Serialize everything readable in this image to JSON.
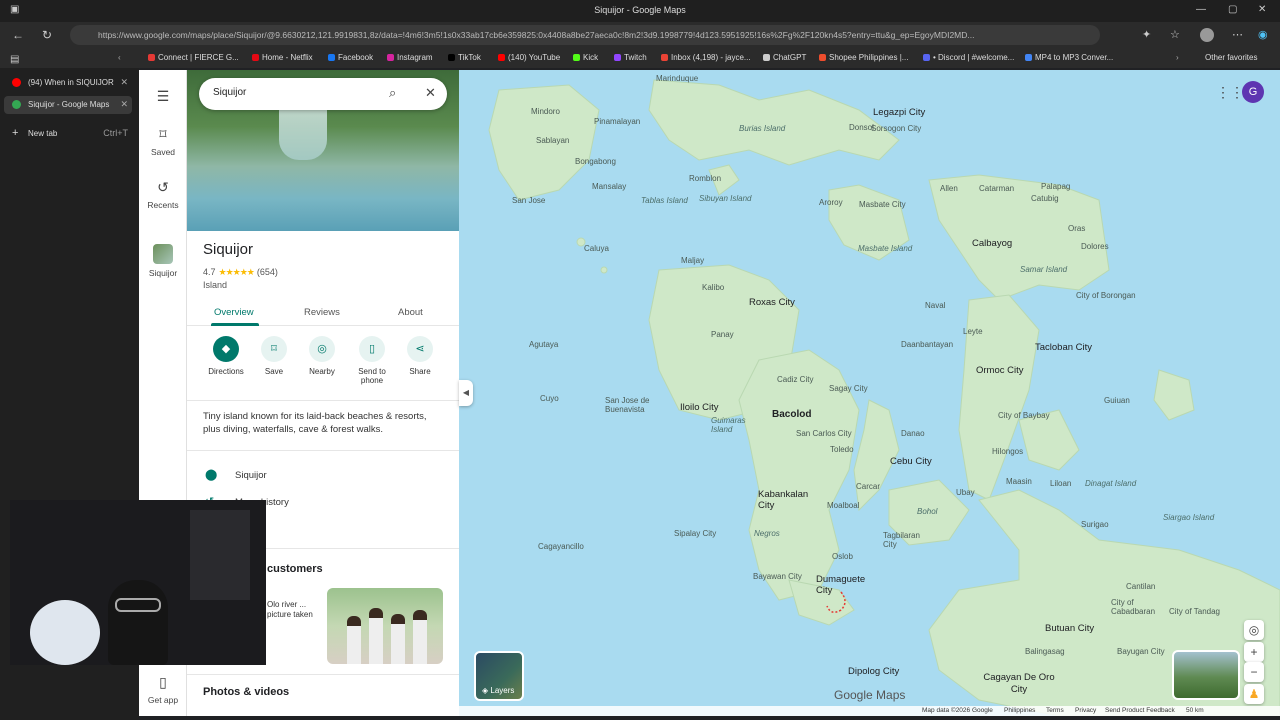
{
  "window": {
    "title": "Siquijor - Google Maps"
  },
  "browser": {
    "url": "https://www.google.com/maps/place/Siquijor/@9.6630212,121.9919831,8z/data=!4m6!3m5!1s0x33ab17cb6e359825:0x4408a8be27aeca0c!8m2!3d9.1998779!4d123.5951925!16s%2Fg%2F120kn4s5?entry=ttu&g_ep=EgoyMDI2MD...",
    "bookmarks": [
      {
        "label": "Connect | FIERCE G...",
        "color": "#e53935"
      },
      {
        "label": "Home - Netflix",
        "color": "#e50914"
      },
      {
        "label": "Facebook",
        "color": "#1877f2"
      },
      {
        "label": "Instagram",
        "color": "#d6249f"
      },
      {
        "label": "TikTok",
        "color": "#000000"
      },
      {
        "label": "(140) YouTube",
        "color": "#ff0000"
      },
      {
        "label": "Kick",
        "color": "#53fc18"
      },
      {
        "label": "Twitch",
        "color": "#9146ff"
      },
      {
        "label": "Inbox (4,198) - jayce...",
        "color": "#ea4335"
      },
      {
        "label": "ChatGPT",
        "color": "#cccccc"
      },
      {
        "label": "Shopee Philippines |...",
        "color": "#ee4d2d"
      },
      {
        "label": "• Discord | #welcome...",
        "color": "#5865f2"
      },
      {
        "label": "MP4 to MP3 Conver...",
        "color": "#4285f4"
      }
    ],
    "other_favorites": "Other favorites",
    "tabs": [
      {
        "label": "(94) When in SIQUIJOR",
        "color": "#ff0000",
        "active": false
      },
      {
        "label": "Siquijor - Google Maps",
        "color": "#34a853",
        "active": true
      }
    ],
    "new_tab": "New tab",
    "new_tab_shortcut": "Ctrl+T"
  },
  "rail": {
    "saved": "Saved",
    "recents": "Recents",
    "recent_place": "Siquijor",
    "get_app": "Get app"
  },
  "search": {
    "value": "Siquijor"
  },
  "place": {
    "name": "Siquijor",
    "rating": "4.7",
    "stars": "★★★★★",
    "reviews": "(654)",
    "type": "Island",
    "tabs": [
      "Overview",
      "Reviews",
      "About"
    ],
    "actions": [
      {
        "label": "Directions",
        "icon": "◆"
      },
      {
        "label": "Save",
        "icon": "⌑"
      },
      {
        "label": "Nearby",
        "icon": "◎"
      },
      {
        "label": "Send to phone",
        "icon": "▯"
      },
      {
        "label": "Share",
        "icon": "⋖"
      }
    ],
    "description": "Tiny island known for its laid-back beaches & resorts, plus diving, waterfalls, cave & forest walks.",
    "info_rows": [
      {
        "label": "Siquijor",
        "icon": "location-pin-icon"
      },
      {
        "label": "Maps history",
        "icon": "history-icon"
      },
      {
        "label": "abel",
        "icon": "label-icon"
      }
    ],
    "section_title": "customers",
    "card_text": "Olo river ... picture taken",
    "photos_title": "Photos & videos"
  },
  "map": {
    "labels": [
      {
        "t": "Marinduque",
        "k": "lbl"
      },
      {
        "t": "Mindoro",
        "k": "lbl"
      },
      {
        "t": "Legazpi City",
        "k": "city"
      },
      {
        "t": "Sorsogon City",
        "k": "lbl"
      },
      {
        "t": "Burias Island",
        "k": "isl"
      },
      {
        "t": "Donsol",
        "k": "lbl"
      },
      {
        "t": "Sablayan",
        "k": "lbl"
      },
      {
        "t": "Pinamalayan",
        "k": "lbl"
      },
      {
        "t": "Bongabong",
        "k": "lbl"
      },
      {
        "t": "Romblon",
        "k": "lbl"
      },
      {
        "t": "Mansalay",
        "k": "lbl"
      },
      {
        "t": "San Jose",
        "k": "lbl"
      },
      {
        "t": "Tablas Island",
        "k": "isl"
      },
      {
        "t": "Sibuyan Island",
        "k": "isl"
      },
      {
        "t": "Aroroy",
        "k": "lbl"
      },
      {
        "t": "Masbate City",
        "k": "lbl"
      },
      {
        "t": "Allen",
        "k": "lbl"
      },
      {
        "t": "Catarman",
        "k": "lbl"
      },
      {
        "t": "Palapag",
        "k": "lbl"
      },
      {
        "t": "Catubig",
        "k": "lbl"
      },
      {
        "t": "Masbate Island",
        "k": "isl"
      },
      {
        "t": "Calbayog",
        "k": "city"
      },
      {
        "t": "Oras",
        "k": "lbl"
      },
      {
        "t": "Dolores",
        "k": "lbl"
      },
      {
        "t": "Samar Island",
        "k": "isl"
      },
      {
        "t": "Caluya",
        "k": "lbl"
      },
      {
        "t": "Maljay",
        "k": "lbl"
      },
      {
        "t": "Kalibo",
        "k": "lbl"
      },
      {
        "t": "Roxas City",
        "k": "city"
      },
      {
        "t": "Naval",
        "k": "lbl"
      },
      {
        "t": "City of Borongan",
        "k": "lbl"
      },
      {
        "t": "Panay",
        "k": "lbl"
      },
      {
        "t": "Leyte",
        "k": "lbl"
      },
      {
        "t": "Agutaya",
        "k": "lbl"
      },
      {
        "t": "Daanbantayan",
        "k": "lbl"
      },
      {
        "t": "Tacloban City",
        "k": "city"
      },
      {
        "t": "Ormoc City",
        "k": "city"
      },
      {
        "t": "Cadiz City",
        "k": "lbl"
      },
      {
        "t": "Sagay City",
        "k": "lbl"
      },
      {
        "t": "Cuyo",
        "k": "lbl"
      },
      {
        "t": "San Jose de Buenavista",
        "k": "lbl"
      },
      {
        "t": "Iloilo City",
        "k": "city"
      },
      {
        "t": "Bacolod",
        "k": "big"
      },
      {
        "t": "Guimaras Island",
        "k": "isl"
      },
      {
        "t": "City of Baybay",
        "k": "lbl"
      },
      {
        "t": "Guiuan",
        "k": "lbl"
      },
      {
        "t": "San Carlos City",
        "k": "lbl"
      },
      {
        "t": "Danao",
        "k": "lbl"
      },
      {
        "t": "Toledo",
        "k": "lbl"
      },
      {
        "t": "Cebu City",
        "k": "city"
      },
      {
        "t": "Hilongos",
        "k": "lbl"
      },
      {
        "t": "Maasin",
        "k": "lbl"
      },
      {
        "t": "Liloan",
        "k": "lbl"
      },
      {
        "t": "Dinagat Island",
        "k": "isl"
      },
      {
        "t": "Kabankalan City",
        "k": "city"
      },
      {
        "t": "Carcar",
        "k": "lbl"
      },
      {
        "t": "Ubay",
        "k": "lbl"
      },
      {
        "t": "Moalboal",
        "k": "lbl"
      },
      {
        "t": "Bohol",
        "k": "isl"
      },
      {
        "t": "Surigao",
        "k": "lbl"
      },
      {
        "t": "Siargao Island",
        "k": "isl"
      },
      {
        "t": "Negros",
        "k": "isl"
      },
      {
        "t": "Sipalay City",
        "k": "lbl"
      },
      {
        "t": "Tagbilaran City",
        "k": "lbl"
      },
      {
        "t": "Cagayancillo",
        "k": "lbl"
      },
      {
        "t": "Oslob",
        "k": "lbl"
      },
      {
        "t": "Bayawan City",
        "k": "lbl"
      },
      {
        "t": "Dumaguete City",
        "k": "city"
      },
      {
        "t": "Cantilan",
        "k": "lbl"
      },
      {
        "t": "City of Cabadbaran",
        "k": "lbl"
      },
      {
        "t": "City of Tandag",
        "k": "lbl"
      },
      {
        "t": "Butuan City",
        "k": "city"
      },
      {
        "t": "Balingasag",
        "k": "lbl"
      },
      {
        "t": "Bayugan City",
        "k": "lbl"
      },
      {
        "t": "Dipolog City",
        "k": "city"
      },
      {
        "t": "Cagayan De Oro City",
        "k": "city"
      }
    ],
    "layers": "Layers",
    "brand": "Google Maps",
    "footer": [
      "Map data ©2026 Google",
      "Philippines",
      "Terms",
      "Privacy",
      "Send Product Feedback",
      "50 km"
    ]
  }
}
